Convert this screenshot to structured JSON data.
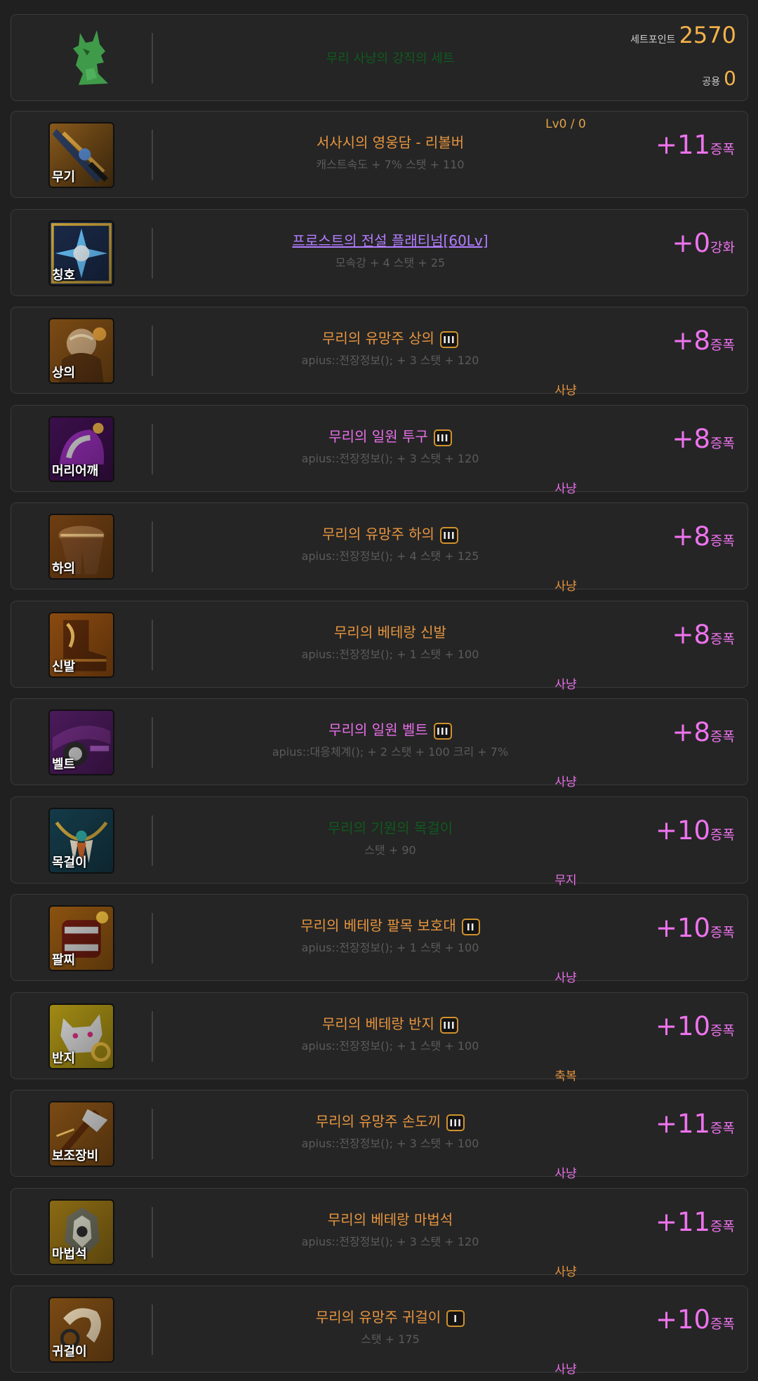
{
  "header": {
    "set_name": "무리 사냥의 강직의 세트",
    "set_point_label": "세트포인트",
    "set_point_value": "2570",
    "shared_label": "공용",
    "shared_value": "0",
    "icon": "wolf-emblem-icon"
  },
  "items": [
    {
      "slot": "무기",
      "name": "서사시의 영웅담 - 리볼버",
      "name_color": "#e7953f",
      "badge": "",
      "stats": "캐스트속도 + 7% 스탯 + 110",
      "enh_value": "+11",
      "enh_unit": "증폭",
      "tag": "",
      "tag_color": "",
      "level": "Lv0 / 0",
      "icon": "revolver-icon"
    },
    {
      "slot": "칭호",
      "name": "프로스트의 전설 플래티넘[60Lv]",
      "name_color": "#b27dff",
      "badge": "",
      "stats": "모속강 + 4 스탯 + 25",
      "enh_value": "+0",
      "enh_unit": "강화",
      "tag": "",
      "tag_color": "",
      "level": "",
      "icon": "frost-title-icon",
      "underline": true
    },
    {
      "slot": "상의",
      "name": "무리의 유망주 상의",
      "name_color": "#e7953f",
      "badge": "III",
      "stats": "apius::전장정보(); + 3 스탯 + 120",
      "enh_value": "+8",
      "enh_unit": "증폭",
      "tag": "사냥",
      "tag_color": "#e7953f",
      "level": "",
      "icon": "jacket-icon"
    },
    {
      "slot": "머리어깨",
      "name": "무리의 일원 투구",
      "name_color": "#e86fe8",
      "badge": "III",
      "stats": "apius::전장정보(); + 3 스탯 + 120",
      "enh_value": "+8",
      "enh_unit": "증폭",
      "tag": "사냥",
      "tag_color": "#e86fe8",
      "level": "",
      "icon": "helmet-icon"
    },
    {
      "slot": "하의",
      "name": "무리의 유망주 하의",
      "name_color": "#e7953f",
      "badge": "III",
      "stats": "apius::전장정보(); + 4 스탯 + 125",
      "enh_value": "+8",
      "enh_unit": "증폭",
      "tag": "사냥",
      "tag_color": "#e7953f",
      "level": "",
      "icon": "pants-icon"
    },
    {
      "slot": "신발",
      "name": "무리의 베테랑 신발",
      "name_color": "#e7953f",
      "badge": "",
      "stats": "apius::전장정보(); + 1 스탯 + 100",
      "enh_value": "+8",
      "enh_unit": "증폭",
      "tag": "사냥",
      "tag_color": "#e86fe8",
      "level": "",
      "icon": "boots-icon"
    },
    {
      "slot": "벨트",
      "name": "무리의 일원 벨트",
      "name_color": "#e86fe8",
      "badge": "III",
      "stats": "apius::대응체계(); + 2 스탯 + 100 크리 + 7%",
      "enh_value": "+8",
      "enh_unit": "증폭",
      "tag": "사냥",
      "tag_color": "#e86fe8",
      "level": "",
      "icon": "belt-icon"
    },
    {
      "slot": "목걸이",
      "name": "무리의 기원의 목걸이",
      "name_color": "#0f5a1e",
      "badge": "",
      "stats": "스탯 + 90",
      "enh_value": "+10",
      "enh_unit": "증폭",
      "tag": "무지",
      "tag_color": "#e86fe8",
      "level": "",
      "icon": "necklace-icon"
    },
    {
      "slot": "팔찌",
      "name": "무리의 베테랑 팔목 보호대",
      "name_color": "#e7953f",
      "badge": "II",
      "stats": "apius::전장정보(); + 1 스탯 + 100",
      "enh_value": "+10",
      "enh_unit": "증폭",
      "tag": "사냥",
      "tag_color": "#e86fe8",
      "level": "",
      "icon": "bracelet-icon"
    },
    {
      "slot": "반지",
      "name": "무리의 베테랑 반지",
      "name_color": "#e7953f",
      "badge": "III",
      "stats": "apius::전장정보(); + 1 스탯 + 100",
      "enh_value": "+10",
      "enh_unit": "증폭",
      "tag": "축복",
      "tag_color": "#e7953f",
      "level": "",
      "icon": "wolf-ring-icon"
    },
    {
      "slot": "보조장비",
      "name": "무리의 유망주 손도끼",
      "name_color": "#e7953f",
      "badge": "III",
      "stats": "apius::전장정보(); + 3 스탯 + 100",
      "enh_value": "+11",
      "enh_unit": "증폭",
      "tag": "사냥",
      "tag_color": "#e86fe8",
      "level": "",
      "icon": "hatchet-icon"
    },
    {
      "slot": "마법석",
      "name": "무리의 베테랑 마법석",
      "name_color": "#e7953f",
      "badge": "",
      "stats": "apius::전장정보(); + 3 스탯 + 120",
      "enh_value": "+11",
      "enh_unit": "증폭",
      "tag": "사냥",
      "tag_color": "#e7953f",
      "level": "",
      "icon": "magic-stone-icon"
    },
    {
      "slot": "귀걸이",
      "name": "무리의 유망주 귀걸이",
      "name_color": "#e7953f",
      "badge": "I",
      "stats": "스탯 + 175",
      "enh_value": "+10",
      "enh_unit": "증폭",
      "tag": "사냥",
      "tag_color": "#e86fe8",
      "level": "",
      "icon": "horn-earring-icon"
    }
  ]
}
